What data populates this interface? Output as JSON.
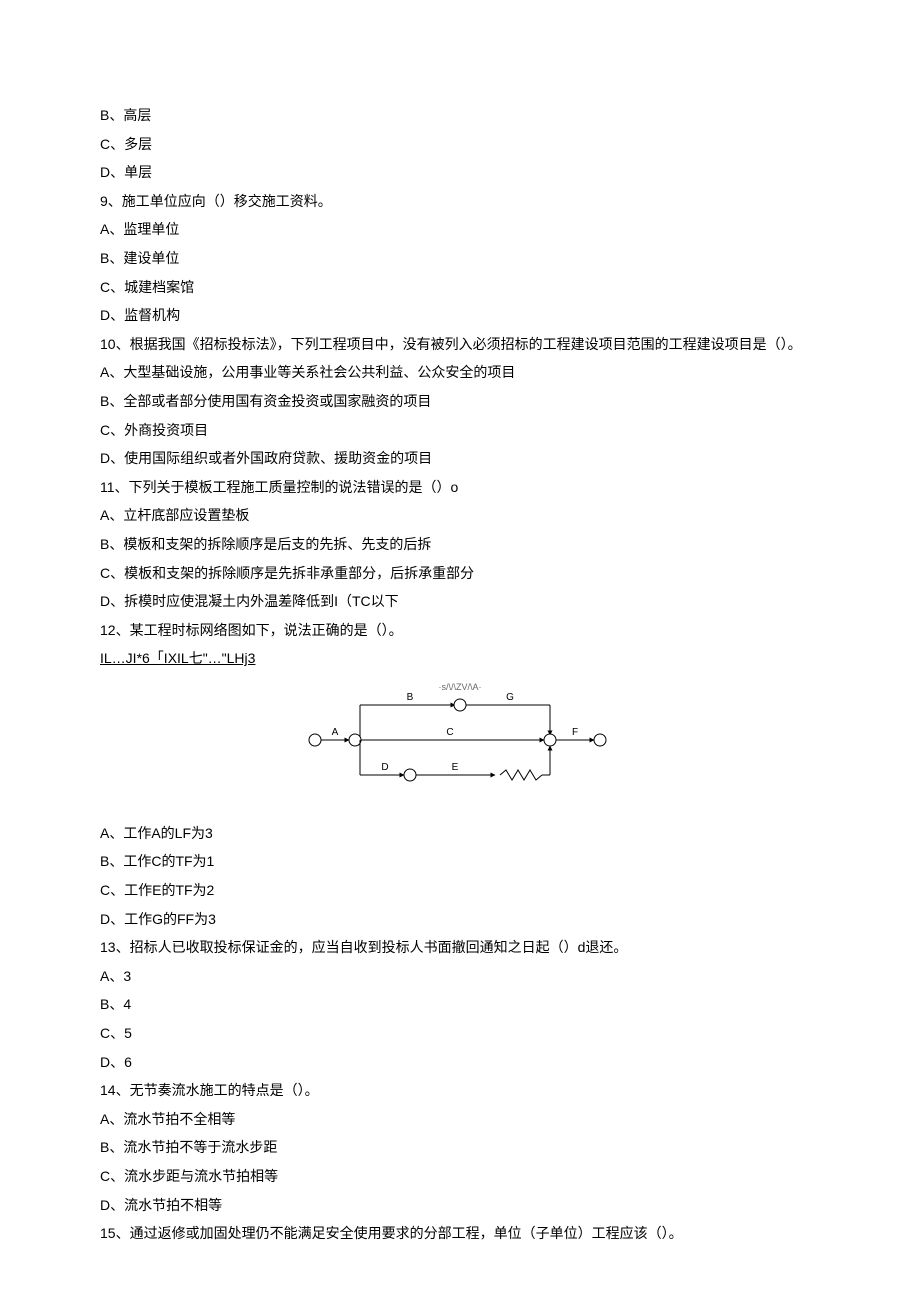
{
  "lines": [
    "B、高层",
    "C、多层",
    "D、单层",
    "9、施工单位应向（）移交施工资料。",
    "A、监理单位",
    "B、建设单位",
    "C、城建档案馆",
    "D、监督机构",
    "10、根据我国《招标投标法》，下列工程项目中，没有被列入必须招标的工程建设项目范围的工程建设项目是（）。",
    "A、大型基础设施，公用事业等关系社会公共利益、公众安全的项目",
    "B、全部或者部分使用国有资金投资或国家融资的项目",
    "C、外商投资项目",
    "D、使用国际组织或者外国政府贷款、援助资金的项目",
    "11、下列关于模板工程施工质量控制的说法错误的是（）o",
    "A、立杆底部应设置垫板",
    "B、模板和支架的拆除顺序是后支的先拆、先支的后拆",
    "C、模板和支架的拆除顺序是先拆非承重部分，后拆承重部分",
    "D、拆模时应使混凝土内外温差降低到I（TC以下",
    "12、某工程时标网络图如下，说法正确的是（）。"
  ],
  "underline": "IL…JI*6「IXIL七\"…\"LHj3",
  "diagram_caption": "·s/\\/\\ZV/\\A·",
  "diagram_labels": {
    "A": "A",
    "B": "B",
    "C": "C",
    "D": "D",
    "E": "E",
    "F": "F",
    "G": "G"
  },
  "lines2": [
    "A、工作A的LF为3",
    "B、工作C的TF为1",
    "C、工作E的TF为2",
    "D、工作G的FF为3",
    "13、招标人已收取投标保证金的，应当自收到投标人书面撤回通知之日起（）d退还。",
    "A、3",
    "B、4",
    "C、5",
    "D、6",
    "14、无节奏流水施工的特点是（）。",
    "A、流水节拍不全相等",
    "B、流水节拍不等于流水步距",
    "C、流水步距与流水节拍相等",
    "D、流水节拍不相等",
    "15、通过返修或加固处理仍不能满足安全使用要求的分部工程，单位（子单位）工程应该（）。"
  ]
}
